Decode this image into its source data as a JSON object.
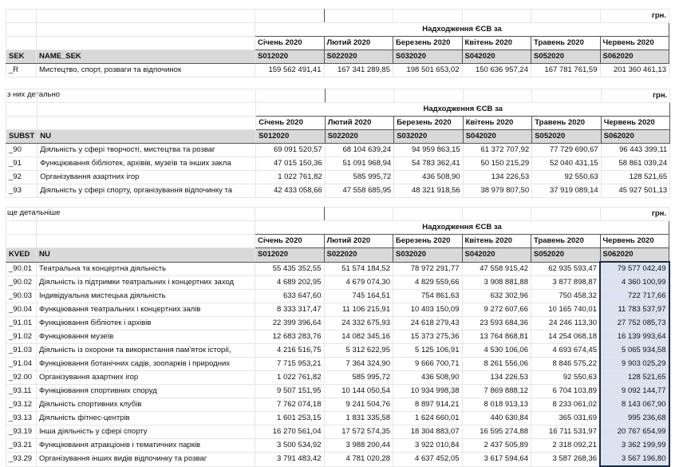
{
  "unit": "грн.",
  "title": "Надходження ЄСВ  за",
  "months": [
    "Січень 2020",
    "Лютий 2020",
    "Березень 2020",
    "Квітень 2020",
    "Травень 2020",
    "Червень 2020"
  ],
  "codes": [
    "S012020",
    "S022020",
    "S032020",
    "S042020",
    "S052020",
    "S062020"
  ],
  "block1": {
    "key_header": "SEK",
    "name_header": "NAME_SEK",
    "rows": [
      {
        "code": "_R",
        "name": "Мистецтво, спорт, розваги та відпочинок",
        "values": [
          "159 562 491,41",
          "167 341 289,85",
          "198 501 653,02",
          "150 636 957,24",
          "167 781 761,59",
          "201 360 461,13"
        ]
      }
    ]
  },
  "block2": {
    "note": "з них детально",
    "key_header": "SUBST",
    "name_header": "NU",
    "rows": [
      {
        "code": "_90",
        "name": "Діяльність у сфері творчості, мистецтва та розваг",
        "values": [
          "69 091 520,57",
          "68 104 639,24",
          "94 959 863,15",
          "61 372 707,92",
          "77 729 690,67",
          "96 443 399,11"
        ]
      },
      {
        "code": "_91",
        "name": "Функціювання бібліотек, архівів, музеїв та інших закла",
        "values": [
          "47 015 150,36",
          "51 091 968,94",
          "54 783 362,41",
          "50 150 215,29",
          "52 040 431,15",
          "58 861 039,24"
        ]
      },
      {
        "code": "_92",
        "name": "Організування азартних ігор",
        "values": [
          "1 022 761,82",
          "585 995,72",
          "436 508,90",
          "134 226,53",
          "92 550,63",
          "128 521,65"
        ]
      },
      {
        "code": "_93",
        "name": "Діяльність у сфері спорту, організування відпочинку та",
        "values": [
          "42 433 058,66",
          "47 558 685,95",
          "48 321 918,56",
          "38 979 807,50",
          "37 919 089,14",
          "45 927 501,13"
        ]
      }
    ]
  },
  "block3": {
    "note": "ще детальніше",
    "key_header": "KVED",
    "name_header": "NU",
    "rows": [
      {
        "code": "_90.01",
        "name": "Театральна та концертна діяльність",
        "values": [
          "55 435 352,55",
          "51 574 184,52",
          "78 972 291,77",
          "47 558 915,42",
          "62 935 593,47",
          "79 577 042,49"
        ]
      },
      {
        "code": "_90.02",
        "name": "Діяльність із підтримки театральних і концертних заход",
        "values": [
          "4 689 202,95",
          "4 679 074,30",
          "4 829 559,66",
          "3 908 881,88",
          "3 877 898,87",
          "4 360 100,99"
        ]
      },
      {
        "code": "_90.03",
        "name": "Індивідуальна мистецька діяльність",
        "values": [
          "633 647,60",
          "745 164,51",
          "754 861,63",
          "632 302,96",
          "750 458,32",
          "722 717,66"
        ]
      },
      {
        "code": "_90.04",
        "name": "Функціювання театральних і концертних залів",
        "values": [
          "8 333 317,47",
          "11 106 215,91",
          "10 403 150,09",
          "9 272 607,66",
          "10 165 740,01",
          "11 783 537,97"
        ]
      },
      {
        "code": "_91.01",
        "name": "Функціювання бібліотек і архівів",
        "values": [
          "22 399 396,64",
          "24 332 675,93",
          "24 618 279,43",
          "23 593 684,36",
          "24 246 113,30",
          "27 752 085,73"
        ]
      },
      {
        "code": "_91.02",
        "name": "Функціювання музеїв",
        "values": [
          "12 683 283,76",
          "14 082 345,16",
          "15 373 275,36",
          "13 764 868,81",
          "14 254 068,18",
          "16 139 993,64"
        ]
      },
      {
        "code": "_91.03",
        "name": "Діяльність із охорони  та використання пам'яток історії,",
        "values": [
          "4 216 516,75",
          "5 312 622,95",
          "5 125 106,91",
          "4 530 106,06",
          "4 693 674,45",
          "5 065 934,58"
        ]
      },
      {
        "code": "_91.04",
        "name": "Функціювання ботанічних садів, зоопарків і природних",
        "values": [
          "7 715 953,21",
          "7 364 324,90",
          "9 666 700,71",
          "8 261 556,06",
          "8 846 575,22",
          "9 903 025,29"
        ]
      },
      {
        "code": "_92.00",
        "name": "Організування азартних ігор",
        "values": [
          "1 022 761,82",
          "585 995,72",
          "436 508,90",
          "134 226,53",
          "92 550,63",
          "128 521,65"
        ]
      },
      {
        "code": "_93.11",
        "name": "Функціювання спортивних споруд",
        "values": [
          "9 507 151,95",
          "10 144 050,54",
          "10 934 998,38",
          "7 869 888,12",
          "6 704 103,89",
          "9 092 144,77"
        ]
      },
      {
        "code": "_93.12",
        "name": "Діяльність спортивних клубів",
        "values": [
          "7 762 074,18",
          "9 241 504,76",
          "8 897 914,21",
          "8 018 913,13",
          "8 233 061,02",
          "8 143 067,90"
        ]
      },
      {
        "code": "_93.13",
        "name": "Діяльність фітнес-центрів",
        "values": [
          "1 601 253,15",
          "1 831 335,58",
          "1 624 660,01",
          "440 630,84",
          "365 031,69",
          "995 236,68"
        ]
      },
      {
        "code": "_93.19",
        "name": "Інша діяльність у сфері спорту",
        "values": [
          "16 270 561,04",
          "17 572 574,35",
          "18 304 883,07",
          "16 595 274,88",
          "16 711 531,97",
          "20 767 654,99"
        ]
      },
      {
        "code": "_93.21",
        "name": "Функціювання атракціонів і тематичних парків",
        "values": [
          "3 500 534,92",
          "3 988 200,44",
          "3 922 010,84",
          "2 437 505,89",
          "2 318 092,21",
          "3 362 199,99"
        ]
      },
      {
        "code": "_93.29",
        "name": "Організування інших видів відпочинку та розваг",
        "values": [
          "3 791 483,42",
          "4 781 020,28",
          "4 637 452,05",
          "3 617 594,64",
          "3 587 268,36",
          "3 567 196,80"
        ]
      }
    ]
  }
}
